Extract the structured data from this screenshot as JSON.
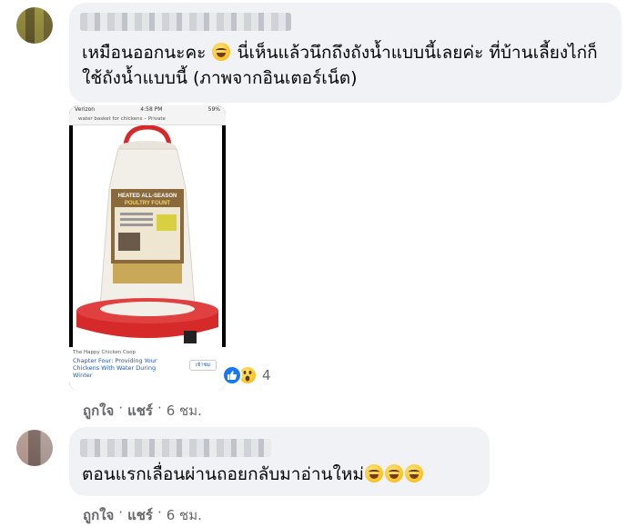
{
  "comments": [
    {
      "text_before_emoji": "เหมือนออกนะคะ",
      "text_after_emoji": "นี่เห็นแล้วนึกถึงถังน้ำแบบนี้เลยค่ะ ที่บ้านเลี้ยงไก่ก็ใช้ถังน้ำแบบนี้ (ภาพจากอินเตอร์เน็ต)",
      "emoji_icon": "grinning-face-icon",
      "shared_image": {
        "status_carrier": "Verizon",
        "status_time": "4:58 PM",
        "status_battery": "59%",
        "url_text": "water basket for chickens – Private",
        "product_label_line1": "HEATED ALL-SEASON",
        "product_label_line2": "POULTRY FOUNT",
        "caption_site": "The Happy Chicken Coop",
        "caption_title": "Chapter Four: Providing Your Chickens With Water During Winter",
        "caption_button": "เข้าชม"
      },
      "reactions": {
        "icons": [
          "like-icon",
          "wow-icon"
        ],
        "count": "4"
      },
      "actions": {
        "like": "ถูกใจ",
        "share": "แชร์",
        "separator": "·",
        "time": "6 ชม."
      }
    },
    {
      "text": "ตอนแรกเลื่อนผ่านถอยกลับมาอ่านใหม่",
      "emoji_icon": "laughing-face-icon",
      "actions": {
        "like": "ถูกใจ",
        "share": "แชร์",
        "separator": "·",
        "time": "6 ชม."
      }
    }
  ],
  "colors": {
    "bubble": "#f0f2f5",
    "text": "#050505",
    "meta": "#65676b",
    "like_blue": "#1877f2",
    "fount_red": "#d62a2a"
  }
}
